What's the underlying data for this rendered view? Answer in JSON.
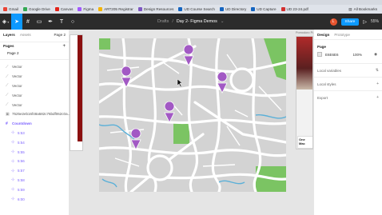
{
  "browser": {
    "bookmarks": [
      {
        "label": "Gmail",
        "color": "#ea4335"
      },
      {
        "label": "Google Drive",
        "color": "#34a853"
      },
      {
        "label": "Canvas",
        "color": "#e2231a"
      },
      {
        "label": "Figma",
        "color": "#a259ff"
      },
      {
        "label": "ART205 Registrar",
        "color": "#f4b400"
      },
      {
        "label": "Design Resources",
        "color": "#7e57c2"
      },
      {
        "label": "UD Course Search",
        "color": "#1565c0"
      },
      {
        "label": "UD Directory",
        "color": "#1565c0"
      },
      {
        "label": "UD Capture",
        "color": "#1565c0"
      },
      {
        "label": "UD 23-24.pdf",
        "color": "#d32f2f"
      }
    ],
    "all_bookmarks": "All Bookmarks"
  },
  "toolbar": {
    "breadcrumb_team": "Drafts",
    "breadcrumb_sep": "/",
    "file_name": "Day 2- Figma Demos",
    "file_caret": "⌄",
    "avatar_letter": "L",
    "share_label": "Share",
    "zoom_label": "55%"
  },
  "left_panel": {
    "tab_layers": "Layers",
    "tab_assets": "Assets",
    "page_selector": "Page 2",
    "pages_header": "Pages",
    "pages": [
      "Page 2"
    ],
    "layers": [
      {
        "label": "Vector",
        "kind": "vector"
      },
      {
        "label": "Vector",
        "kind": "vector"
      },
      {
        "label": "Vector",
        "kind": "vector"
      },
      {
        "label": "Vector",
        "kind": "vector"
      },
      {
        "label": "Vector",
        "kind": "vector"
      },
      {
        "label": "7525e2eb16f48a582c76bdf062c0a...",
        "kind": "image"
      },
      {
        "label": "Countdown",
        "kind": "frame"
      },
      {
        "label": "5:53",
        "kind": "child"
      },
      {
        "label": "5:54",
        "kind": "child"
      },
      {
        "label": "5:55",
        "kind": "child"
      },
      {
        "label": "5:56",
        "kind": "child"
      },
      {
        "label": "5:57",
        "kind": "child"
      },
      {
        "label": "5:58",
        "kind": "child"
      },
      {
        "label": "5:59",
        "kind": "child"
      },
      {
        "label": "6:00",
        "kind": "child"
      }
    ]
  },
  "canvas": {
    "right_frame_label": "Pomodoro Pages",
    "right_card_text": "One Mac"
  },
  "right_panel": {
    "tab_design": "Design",
    "tab_prototype": "Prototype",
    "page_title": "Page",
    "bg_hex": "E6E6E6",
    "bg_opacity": "100%",
    "local_variables": "Local variables",
    "local_styles": "Local styles",
    "export": "Export"
  },
  "colors": {
    "accent": "#0d99ff",
    "toolbar_bg": "#2c2c2c",
    "map_pin": "#a259c4",
    "map_water": "#5bb0d8",
    "map_park": "#7bc463"
  }
}
